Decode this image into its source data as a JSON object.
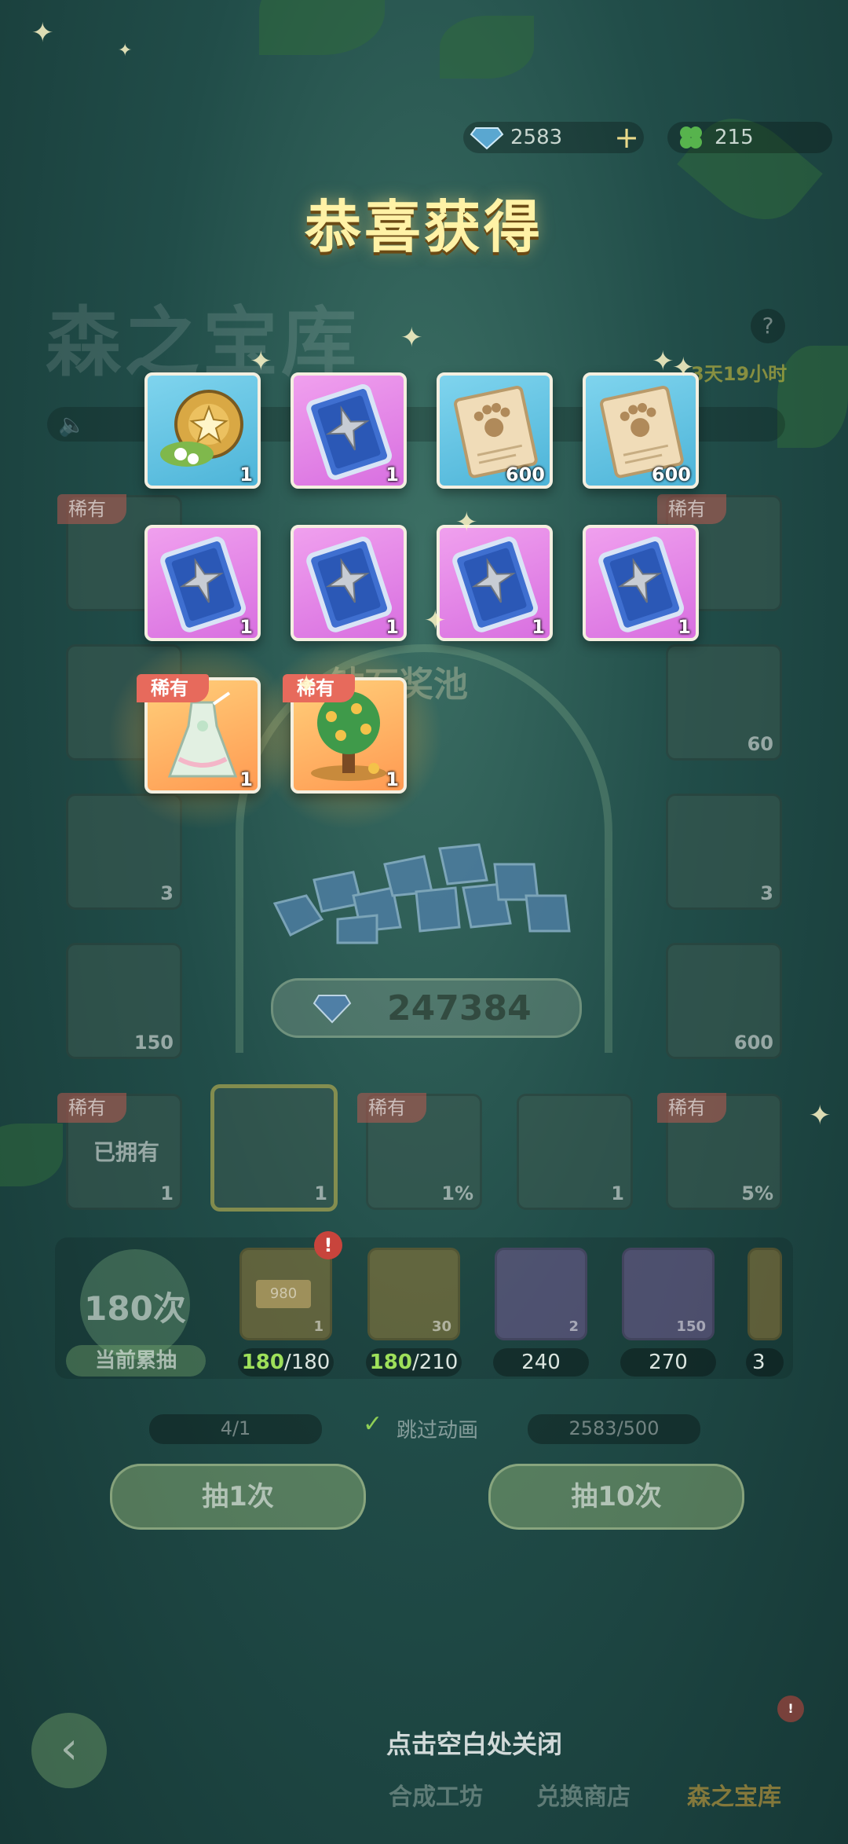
{
  "currency": {
    "diamonds": "2583",
    "clovers": "215"
  },
  "popup": {
    "title": "恭喜获得",
    "close_hint": "点击空白处关闭"
  },
  "background": {
    "page_title": "森之宝库",
    "timer": "3天19小时",
    "help": "?",
    "pool_title": "钻石奖池",
    "pool_total": "247384",
    "rare_tag": "稀有",
    "owned": "已拥有",
    "side_slots": [
      "60",
      "3",
      "3",
      "600",
      "150"
    ],
    "bottom_slots": [
      {
        "count": "1",
        "rare": true,
        "owned": true
      },
      {
        "count": "1",
        "rare": false
      },
      {
        "count": "1%",
        "rare": true
      },
      {
        "count": "1",
        "rare": false
      },
      {
        "count": "5%",
        "rare": true
      }
    ],
    "draw_count": "180次",
    "draw_count_label": "当前累抽",
    "milestones": [
      {
        "count": "1",
        "done": "180",
        "total": "/180"
      },
      {
        "count": "30",
        "done": "180",
        "total": "/210"
      },
      {
        "count": "2",
        "done": "",
        "total": "240"
      },
      {
        "count": "150",
        "done": "",
        "total": "270"
      },
      {
        "count": "",
        "done": "",
        "total": "3"
      }
    ],
    "ticket_count": "4/1",
    "skip_anim": "跳过动画",
    "diamond_cost": "2583/500",
    "draw_one": "抽1次",
    "draw_ten": "抽10次",
    "nav": [
      "合成工坊",
      "兑换商店",
      "森之宝库"
    ],
    "coupon_value": "980"
  },
  "rewards": [
    {
      "icon": "snail-shell-icon",
      "bg": "blue",
      "count": "1"
    },
    {
      "icon": "sword-card-icon",
      "bg": "purple",
      "count": "1"
    },
    {
      "icon": "paw-scroll-icon",
      "bg": "blue",
      "count": "600"
    },
    {
      "icon": "paw-scroll-icon",
      "bg": "blue",
      "count": "600"
    },
    {
      "icon": "sword-card-icon",
      "bg": "purple",
      "count": "1"
    },
    {
      "icon": "sword-card-icon",
      "bg": "purple",
      "count": "1"
    },
    {
      "icon": "sword-card-icon",
      "bg": "purple",
      "count": "1"
    },
    {
      "icon": "sword-card-icon",
      "bg": "purple",
      "count": "1"
    },
    {
      "icon": "dress-icon",
      "bg": "orange",
      "count": "1",
      "tag": "稀有"
    },
    {
      "icon": "money-tree-icon",
      "bg": "orange",
      "count": "1",
      "tag": "稀有"
    }
  ],
  "colors": {
    "rare_tag": "#e76a5c",
    "title": "#fff2a6",
    "progress_done": "#9ee05a"
  }
}
